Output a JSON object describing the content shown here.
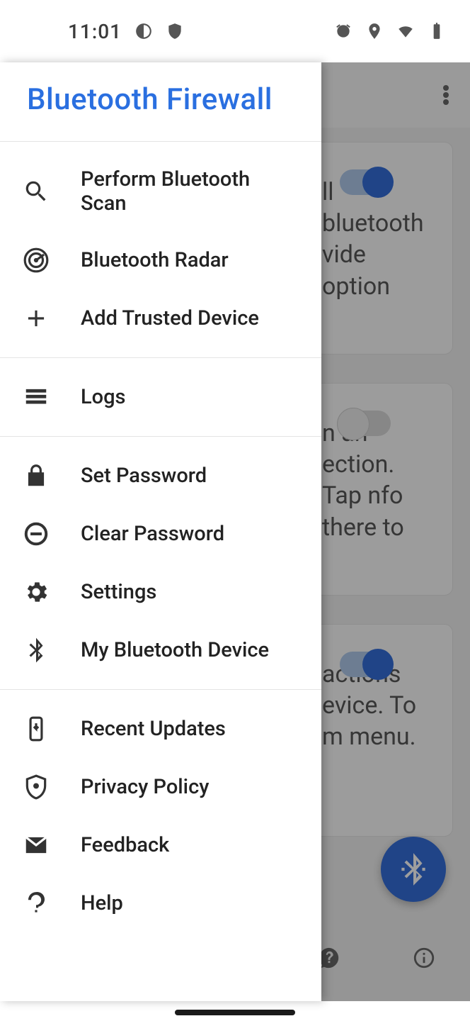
{
  "status": {
    "time": "11:01"
  },
  "drawer": {
    "title": "Bluetooth Firewall",
    "sections": [
      {
        "items": [
          {
            "label": "Perform Bluetooth Scan"
          },
          {
            "label": "Bluetooth Radar"
          },
          {
            "label": "Add Trusted Device"
          }
        ]
      },
      {
        "items": [
          {
            "label": "Logs"
          }
        ]
      },
      {
        "items": [
          {
            "label": "Set Password"
          },
          {
            "label": "Clear Password"
          },
          {
            "label": "Settings"
          },
          {
            "label": "My Bluetooth Device"
          }
        ]
      },
      {
        "items": [
          {
            "label": "Recent Updates"
          },
          {
            "label": "Privacy Policy"
          },
          {
            "label": "Feedback"
          },
          {
            "label": "Help"
          }
        ]
      }
    ]
  },
  "background": {
    "cards": [
      {
        "text": "ll bluetooth vide option",
        "toggle": "on"
      },
      {
        "text": "n an ection. Tap nfo there to",
        "toggle": "off"
      },
      {
        "text": "actions evice. To m menu.",
        "toggle": "on"
      }
    ]
  }
}
